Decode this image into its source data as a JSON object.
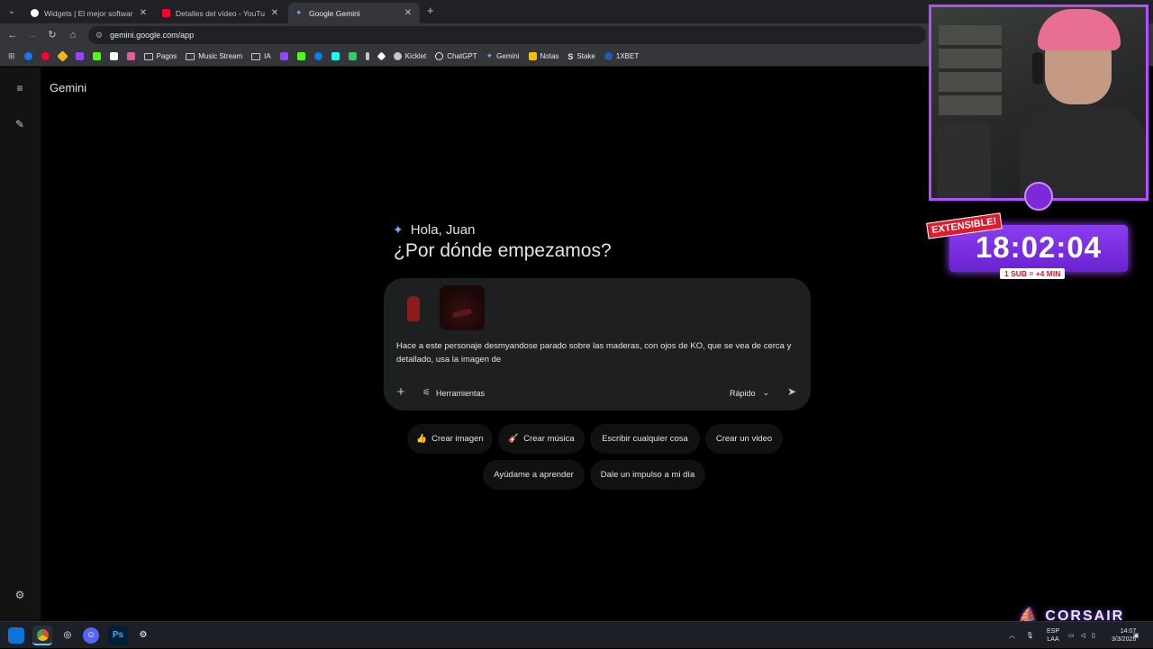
{
  "browser": {
    "tabs": [
      {
        "title": "Widgets | El mejor software para",
        "favicon_color": "#ffffff",
        "active": false
      },
      {
        "title": "Detalles del vídeo - YouTube Studio",
        "favicon_color": "#ff0033",
        "active": false
      },
      {
        "title": "Google Gemini",
        "favicon_color": "#6fa8f5",
        "active": true
      }
    ],
    "url": "gemini.google.com/app",
    "bookmarks": [
      {
        "label": "",
        "color": "#1877f2"
      },
      {
        "label": "",
        "color": "#ff0033"
      },
      {
        "label": "",
        "color": "#f0b90b"
      },
      {
        "label": "",
        "color": "#9146ff"
      },
      {
        "label": "",
        "color": "#53fc18"
      },
      {
        "label": "",
        "color": "#ffffff"
      },
      {
        "label": "",
        "color": "#e05d9a"
      },
      {
        "label": "Pagos",
        "folder": true
      },
      {
        "label": "Music Stream",
        "folder": true
      },
      {
        "label": "IA",
        "folder": true
      },
      {
        "label": "",
        "color": "#9146ff"
      },
      {
        "label": "",
        "color": "#53fc18"
      },
      {
        "label": "",
        "color": "#0081fb"
      },
      {
        "label": "",
        "color": "#25f4ee"
      },
      {
        "label": "",
        "color": "#2ecc71"
      },
      {
        "label": "",
        "color": "#c4c7c5"
      },
      {
        "label": "",
        "color": "#ffffff"
      },
      {
        "label": "Kicklet",
        "color": "#c4c7c5"
      },
      {
        "label": "ChatGPT",
        "color": "#e8eaed"
      },
      {
        "label": "Gemini",
        "color": "#6fa8f5"
      },
      {
        "label": "Notas",
        "color": "#fbbc04"
      },
      {
        "label": "Stake",
        "color": "#e8eaed"
      },
      {
        "label": "1XBET",
        "color": "#1a5fb4"
      }
    ]
  },
  "app": {
    "brand": "Gemini",
    "greeting": "Hola, Juan",
    "headline": "¿Por dónde empezamos?",
    "prompt_text": "Hace a este personaje desmyandose parado sobre las maderas, con ojos de KO, que se vea de cerca y detallado, usa la imagen de",
    "tools_label": "Herramientas",
    "mode_label": "Rápido",
    "chips": [
      {
        "icon": "👍",
        "label": "Crear imagen"
      },
      {
        "icon": "🎸",
        "label": "Crear música"
      },
      {
        "icon": "",
        "label": "Escribir cualquier cosa"
      },
      {
        "icon": "",
        "label": "Crear un video"
      },
      {
        "icon": "",
        "label": "Ayúdame a aprender"
      },
      {
        "icon": "",
        "label": "Dale un impulso a mi día"
      }
    ]
  },
  "overlay": {
    "timer": "18:02:04",
    "badge": "EXTENSIBLE!",
    "sub_note": "1 SUB = +4 MIN",
    "sponsor": "CORSAIR"
  },
  "taskbar": {
    "lang_1": "ESP",
    "lang_2": "LAA",
    "time": "14:07",
    "date": "3/3/2026"
  }
}
